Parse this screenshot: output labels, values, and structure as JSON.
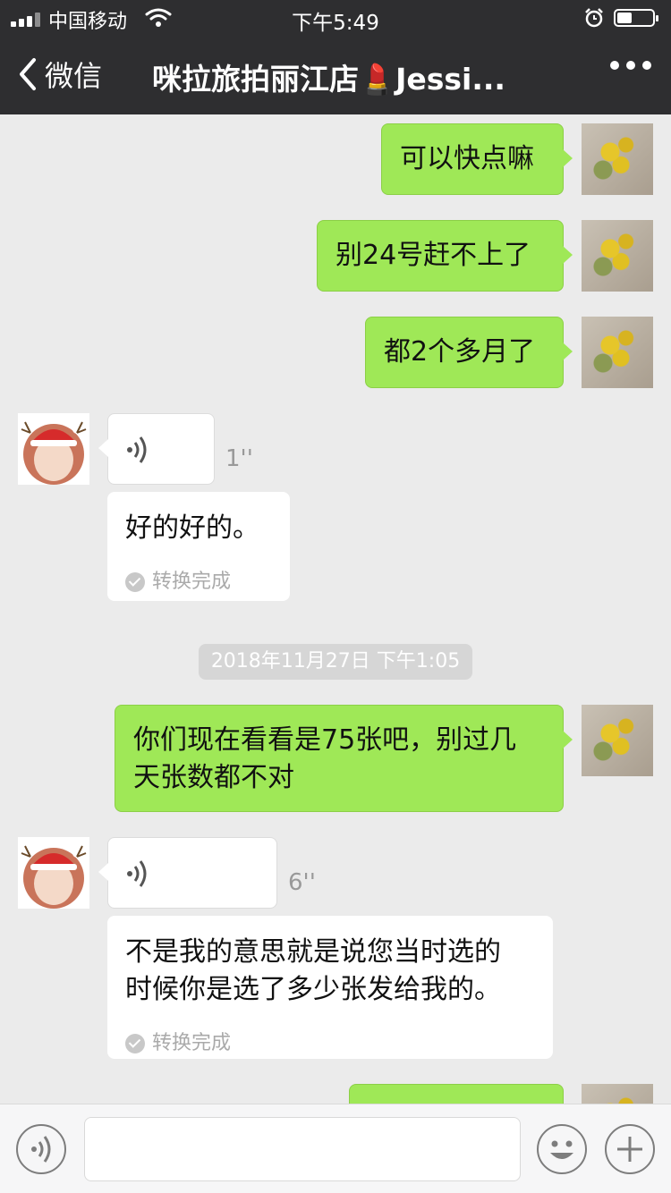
{
  "status_bar": {
    "carrier": "中国移动",
    "time": "下午5:49"
  },
  "nav": {
    "back_label": "微信",
    "title": "咪拉旅拍丽江店💄Jessi...",
    "more_icon": "more-dots-icon"
  },
  "messages": {
    "m1": {
      "sender": "me",
      "text": "可以快点嘛"
    },
    "m2": {
      "sender": "me",
      "text": "别24号赶不上了"
    },
    "m3": {
      "sender": "me",
      "text": "都2个多月了"
    },
    "v1": {
      "sender": "other",
      "type": "voice",
      "duration": "1''",
      "transcript": "好的好的。",
      "status": "转换完成"
    },
    "ts": "2018年11月27日 下午1:05",
    "m4": {
      "sender": "me",
      "text_line1": "你们现在看看是75张吧，别过几",
      "text_line2": "天张数都不对"
    },
    "v2": {
      "sender": "other",
      "type": "voice",
      "duration": "6''",
      "transcript_line1": "不是我的意思就是说您当时选的",
      "transcript_line2": "时候你是选了多少张发给我的。",
      "status": "转换完成"
    }
  },
  "input_bar": {
    "placeholder": "",
    "voice_icon": "voice-icon",
    "emoji_icon": "emoji-icon",
    "plus_icon": "plus-icon"
  }
}
